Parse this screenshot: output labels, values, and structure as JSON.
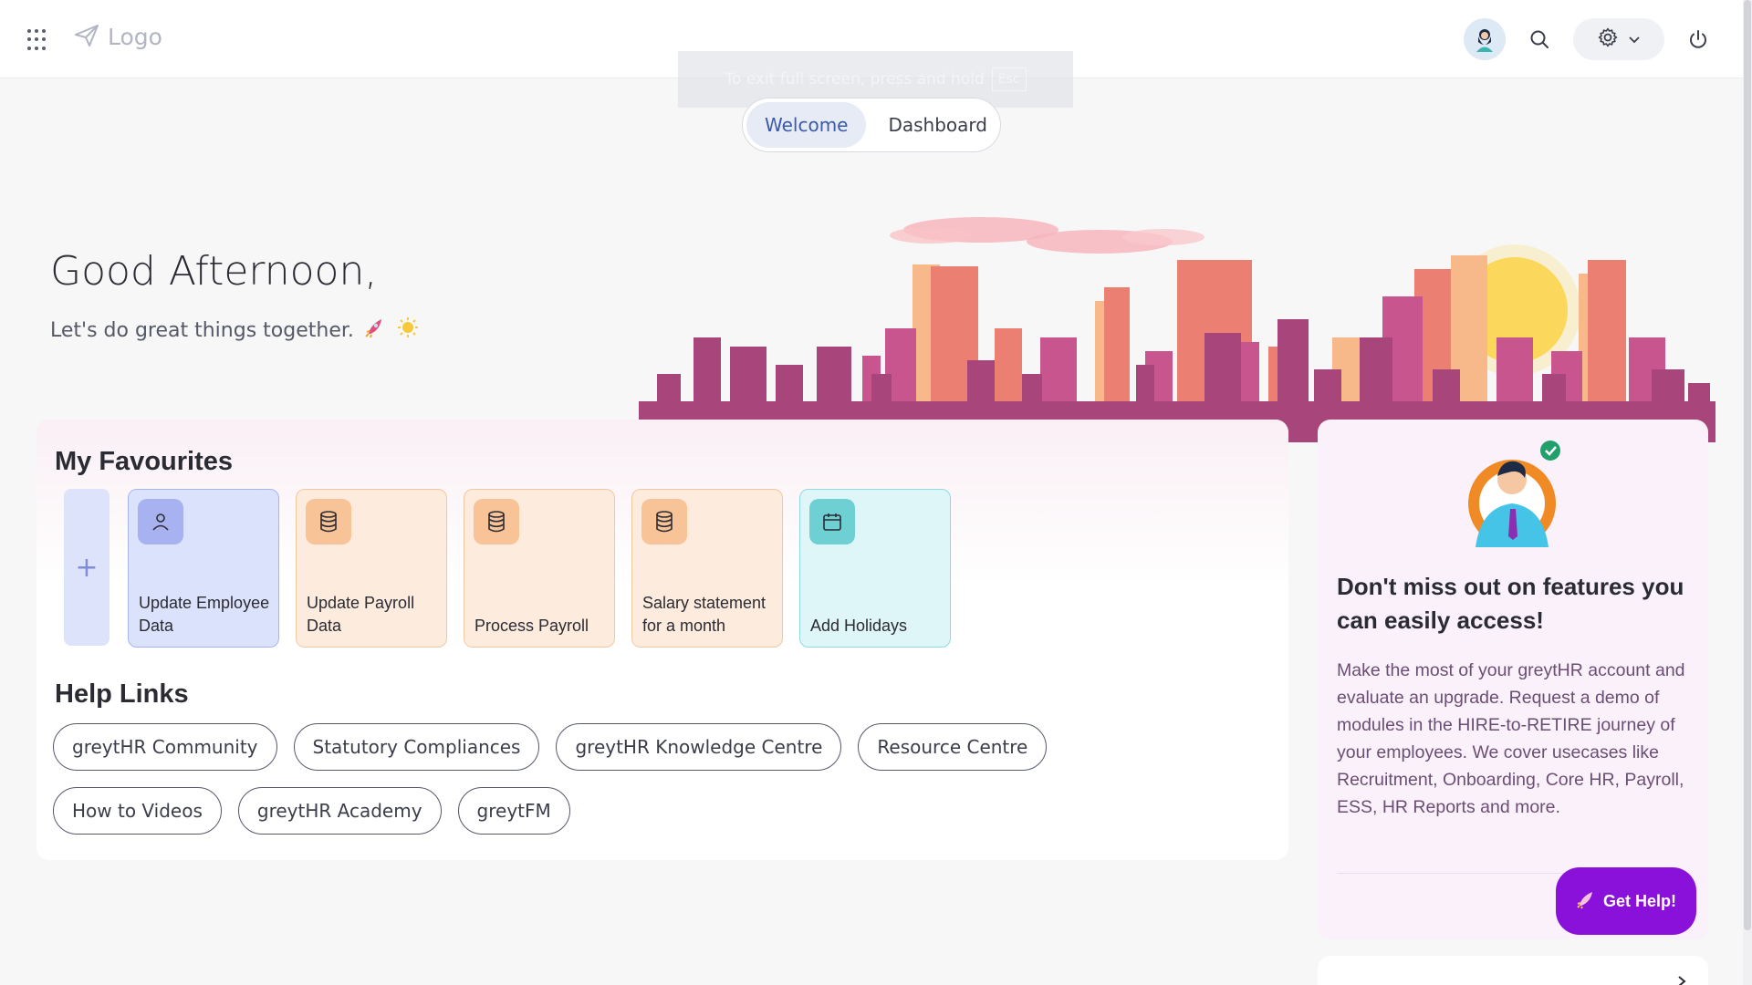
{
  "header": {
    "logo_text": "Logo",
    "icons": {
      "apps": "apps-grid-icon",
      "logo": "paper-plane-icon",
      "avatar": "user-avatar",
      "search": "search-icon",
      "settings": "gear-icon",
      "power": "power-icon"
    }
  },
  "fullscreen_toast": {
    "text": "To exit full screen, press and hold",
    "key": "Esc"
  },
  "tabs": [
    {
      "label": "Welcome",
      "active": true
    },
    {
      "label": "Dashboard",
      "active": false
    }
  ],
  "greeting": {
    "title": "Good Afternoon,",
    "subtitle": "Let's do great things together."
  },
  "favourites": {
    "title": "My Favourites",
    "add_label": "+",
    "items": [
      {
        "label": "Update Employee Data",
        "icon": "user-icon",
        "bg": "#dbe2fb",
        "border": "#a7b5ee",
        "icon_bg": "#a8b2f0"
      },
      {
        "label": "Update Payroll Data",
        "icon": "database-icon",
        "bg": "#fdebdd",
        "border": "#f3c89f",
        "icon_bg": "#f8c497"
      },
      {
        "label": "Process Payroll",
        "icon": "database-icon",
        "bg": "#fdebdd",
        "border": "#f3c89f",
        "icon_bg": "#f8c497"
      },
      {
        "label": "Salary statement for a month",
        "icon": "database-icon",
        "bg": "#fdebdd",
        "border": "#f3c89f",
        "icon_bg": "#f8c497"
      },
      {
        "label": "Add Holidays",
        "icon": "calendar-icon",
        "bg": "#dff6f8",
        "border": "#8fdae0",
        "icon_bg": "#6fd0d4"
      }
    ]
  },
  "help_links": {
    "title": "Help Links",
    "items": [
      "greytHR Community",
      "Statutory Compliances",
      "greytHR Knowledge Centre",
      "Resource Centre",
      "How to Videos",
      "greytHR Academy",
      "greytFM"
    ]
  },
  "promo": {
    "title": "Don't miss out on features you can easily access!",
    "body": "Make the most of your greytHR account and evaluate an upgrade. Request a demo of modules in the HIRE-to-RETIRE journey of your employees. We cover usecases like Recruitment, Onboarding, Core HR, Payroll, ESS, HR Reports and more."
  },
  "get_help": {
    "label": "Get Help!"
  }
}
